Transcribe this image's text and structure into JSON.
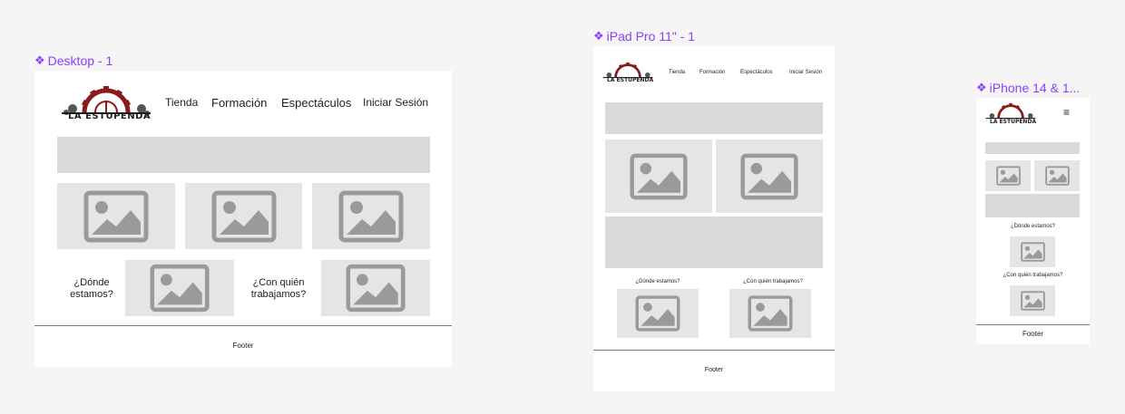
{
  "frames": {
    "desktop": {
      "label": "Desktop - 1",
      "logo_text": "LA ESTUPENDA",
      "nav": [
        "Tienda",
        "Formación",
        "Espectáculos",
        "Iniciar Sesión"
      ],
      "where_label": "¿Dónde estamos?",
      "who_label": "¿Con quién trabajamos?",
      "footer": "Footer"
    },
    "ipad": {
      "label": "iPad Pro 11\" - 1",
      "logo_text": "LA ESTUPENDA",
      "nav": [
        "Tienda",
        "Formación",
        "Espectáculos",
        "Iniciar Sesión"
      ],
      "where_label": "¿Dónde estamos?",
      "who_label": "¿Con quién trabajamos?",
      "footer": "Footer"
    },
    "iphone": {
      "label": "iPhone 14 & 1...",
      "logo_text": "LA ESTUPENDA",
      "menu_icon": "hamburger-menu-icon",
      "where_label": "¿Dónde estamos?",
      "who_label": "¿Con quién trabajamos?",
      "footer": "Footer"
    }
  },
  "colors": {
    "canvas": "#f5f5f5",
    "frame": "#ffffff",
    "placeholder": "#d9d9d9",
    "image_placeholder": "#e5e5e5",
    "image_icon": "#9a9a9a",
    "label_purple": "#8a3ffc",
    "logo_red": "#8b1a1a"
  }
}
